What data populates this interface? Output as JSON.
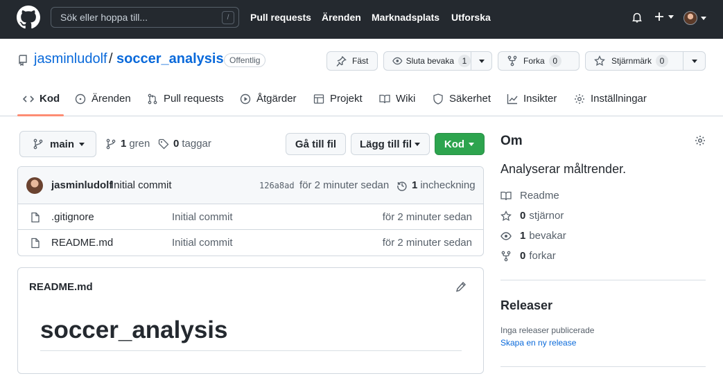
{
  "header": {
    "search_placeholder": "Sök eller hoppa till...",
    "search_shortcut": "/",
    "nav": [
      "Pull requests",
      "Ärenden",
      "Marknadsplats",
      "Utforska"
    ]
  },
  "repo": {
    "owner": "jasminludolf",
    "separator": "/",
    "name": "soccer_analysis",
    "visibility": "Offentlig",
    "pin_label": "Fäst",
    "watch_label": "Sluta bevaka",
    "watch_count": "1",
    "fork_label": "Forka",
    "fork_count": "0",
    "star_label": "Stjärnmärk",
    "star_count": "0"
  },
  "tabs": [
    "Kod",
    "Ärenden",
    "Pull requests",
    "Åtgärder",
    "Projekt",
    "Wiki",
    "Säkerhet",
    "Insikter",
    "Inställningar"
  ],
  "branch_bar": {
    "branch": "main",
    "branches_count": "1",
    "branches_label": "gren",
    "tags_count": "0",
    "tags_label": "taggar",
    "goto_file": "Gå till fil",
    "add_file": "Lägg till fil",
    "code": "Kod"
  },
  "commit": {
    "author": "jasminludolf",
    "message": "Initial commit",
    "sha": "126a8ad",
    "time": "för 2 minuter sedan",
    "count": "1",
    "count_label": "incheckning"
  },
  "files": [
    {
      "name": ".gitignore",
      "commit": "Initial commit",
      "time": "för 2 minuter sedan"
    },
    {
      "name": "README.md",
      "commit": "Initial commit",
      "time": "för 2 minuter sedan"
    }
  ],
  "readme": {
    "label": "README.md",
    "heading": "soccer_analysis"
  },
  "about": {
    "title": "Om",
    "description": "Analyserar måltrender.",
    "readme": "Readme",
    "stars_count": "0",
    "stars_label": "stjärnor",
    "watchers_count": "1",
    "watchers_label": "bevakar",
    "forks_count": "0",
    "forks_label": "forkar"
  },
  "releases": {
    "title": "Releaser",
    "none": "Inga releaser publicerade",
    "create": "Skapa en ny release"
  },
  "colors": {
    "topbar": "#24292f",
    "link": "#0969da",
    "code_button": "#2da44e",
    "active_tab_underline": "#fd8c73"
  }
}
